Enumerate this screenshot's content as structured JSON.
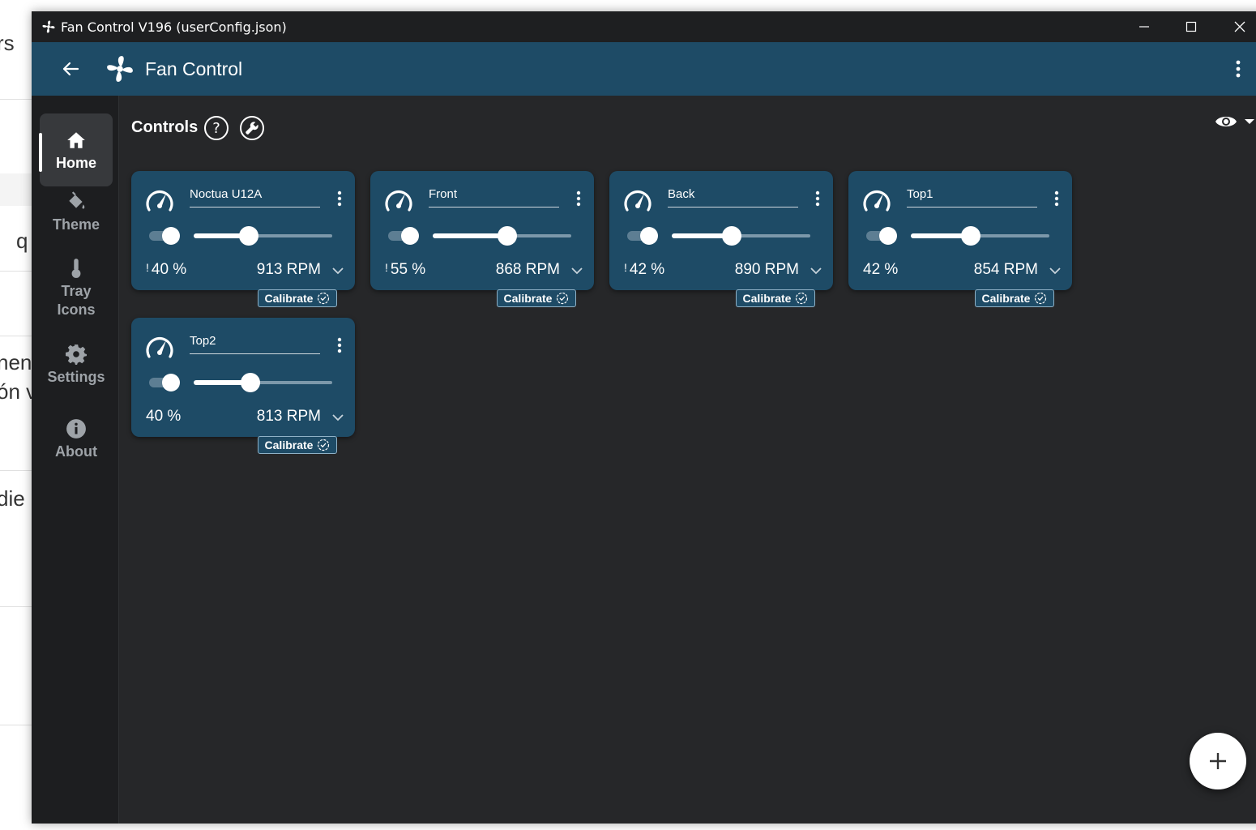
{
  "background_app": {
    "fragments": [
      "rs",
      "q",
      "nen",
      "ón v",
      "die"
    ]
  },
  "window": {
    "title": "Fan Control V196 (userConfig.json)",
    "controls": [
      "minimize-icon",
      "maximize-icon",
      "close-icon"
    ]
  },
  "appbar": {
    "title": "Fan Control",
    "back_icon": "arrow-left-icon",
    "menu_icon": "more-vert-icon"
  },
  "sidebar": {
    "items": [
      {
        "label": "Home",
        "icon": "home-icon",
        "active": true
      },
      {
        "label": "Theme",
        "icon": "paint-bucket-icon",
        "active": false
      },
      {
        "label": "Tray",
        "label2": "Icons",
        "icon": "thermometer-icon",
        "active": false
      },
      {
        "label": "Settings",
        "icon": "gear-icon",
        "active": false
      },
      {
        "label": "About",
        "icon": "info-icon",
        "active": false
      }
    ]
  },
  "content": {
    "section_title": "Controls",
    "help_icon": "help-icon",
    "tools_icon": "wrench-icon",
    "visibility_icon": "eye-icon"
  },
  "controls": [
    {
      "name": "Noctua U12A",
      "percent": "40 %",
      "warning": true,
      "rpm": "913 RPM",
      "slider_fraction": 0.4,
      "enabled": true,
      "calibrate": "Calibrate"
    },
    {
      "name": "Front",
      "percent": "55 %",
      "warning": true,
      "rpm": "868 RPM",
      "slider_fraction": 0.54,
      "enabled": true,
      "calibrate": "Calibrate"
    },
    {
      "name": "Back",
      "percent": "42 %",
      "warning": true,
      "rpm": "890 RPM",
      "slider_fraction": 0.43,
      "enabled": true,
      "calibrate": "Calibrate"
    },
    {
      "name": "Top1",
      "percent": "42 %",
      "warning": false,
      "rpm": "854 RPM",
      "slider_fraction": 0.43,
      "enabled": true,
      "calibrate": "Calibrate"
    },
    {
      "name": "Top2",
      "percent": "40 %",
      "warning": false,
      "rpm": "813 RPM",
      "slider_fraction": 0.41,
      "enabled": true,
      "calibrate": "Calibrate"
    }
  ],
  "fab": {
    "icon": "plus-icon"
  },
  "colors": {
    "appbar": "#1e4b66",
    "card": "#1e4b66",
    "background": "#262729",
    "sidebar": "#1d1e20"
  }
}
